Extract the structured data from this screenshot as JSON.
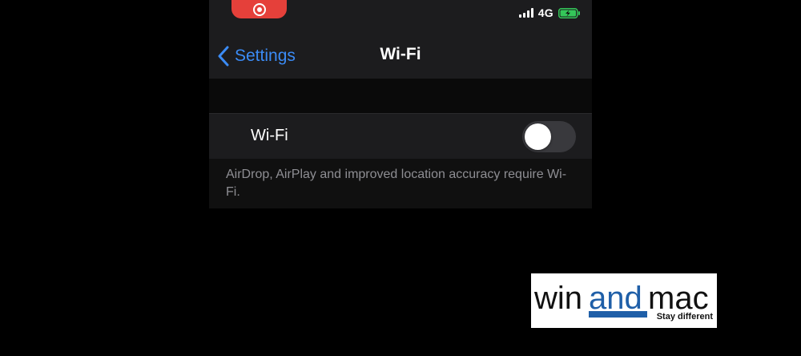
{
  "status_bar": {
    "network": "4G",
    "colors": {
      "record": "#e5403a",
      "battery_fill": "#34c759"
    }
  },
  "nav": {
    "back_label": "Settings",
    "title": "Wi-Fi",
    "accent": "#3b8bf5"
  },
  "wifi_setting": {
    "label": "Wi-Fi",
    "enabled": false
  },
  "footnote": "AirDrop, AirPlay and improved location accuracy require Wi-Fi.",
  "logo": {
    "part1": "win",
    "part2": "and",
    "part3": "mac",
    "tagline": "Stay different",
    "accent": "#1f5fa8"
  }
}
